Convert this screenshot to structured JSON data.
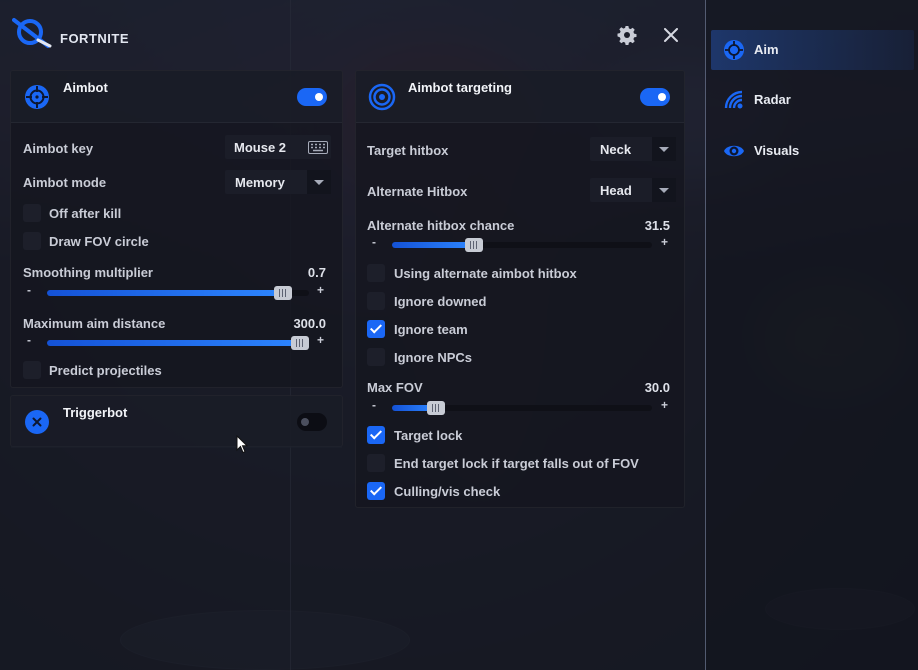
{
  "app": {
    "logo_text": "FORTNITE"
  },
  "colors": {
    "accent": "#1a67f5",
    "panel": "#16182a",
    "text": "#e6e8ee"
  },
  "icons": {
    "logo": "logo-icon",
    "settings": "gear-icon",
    "close": "close-icon",
    "keyboard": "keyboard-icon",
    "cursor": "mouse-cursor"
  },
  "aimbot": {
    "title": "Aimbot",
    "icon": "crosshair-icon",
    "enabled": true,
    "key_label": "Aimbot key",
    "key_value": "Mouse 2",
    "mode_label": "Aimbot mode",
    "mode_value": "Memory",
    "off_after_kill": {
      "label": "Off after kill",
      "checked": false
    },
    "draw_fov_circle": {
      "label": "Draw FOV circle",
      "checked": false
    },
    "smoothing": {
      "label": "Smoothing multiplier",
      "value": "0.7",
      "minus": "-",
      "plus": "+",
      "fill_fraction": 0.9
    },
    "max_distance": {
      "label": "Maximum aim distance",
      "value": "300.0",
      "minus": "-",
      "plus": "+",
      "fill_fraction": 1.0
    },
    "predict_projectiles": {
      "label": "Predict projectiles",
      "checked": false
    }
  },
  "triggerbot": {
    "title": "Triggerbot",
    "icon": "x-circle-icon",
    "enabled": false
  },
  "targeting": {
    "title": "Aimbot targeting",
    "icon": "target-rings-icon",
    "enabled": true,
    "target_hitbox": {
      "label": "Target hitbox",
      "value": "Neck"
    },
    "alternate_hitbox": {
      "label": "Alternate Hitbox",
      "value": "Head"
    },
    "alt_chance": {
      "label": "Alternate hitbox chance",
      "value": "31.5",
      "minus": "-",
      "plus": "+",
      "fill_fraction": 0.315
    },
    "using_alternate": {
      "label": "Using alternate aimbot hitbox",
      "checked": false
    },
    "ignore_downed": {
      "label": "Ignore downed",
      "checked": false
    },
    "ignore_team": {
      "label": "Ignore team",
      "checked": true
    },
    "ignore_npcs": {
      "label": "Ignore NPCs",
      "checked": false
    },
    "max_fov": {
      "label": "Max FOV",
      "value": "30.0",
      "minus": "-",
      "plus": "+",
      "fill_fraction": 0.17
    },
    "target_lock": {
      "label": "Target lock",
      "checked": true
    },
    "end_target_lock": {
      "label": "End target lock if target falls out of FOV",
      "checked": false
    },
    "culling": {
      "label": "Culling/vis check",
      "checked": true
    }
  },
  "sidebar": {
    "items": [
      {
        "label": "Aim",
        "icon": "crosshair-icon",
        "active": true
      },
      {
        "label": "Radar",
        "icon": "radar-icon",
        "active": false
      },
      {
        "label": "Visuals",
        "icon": "eye-icon",
        "active": false
      }
    ]
  }
}
